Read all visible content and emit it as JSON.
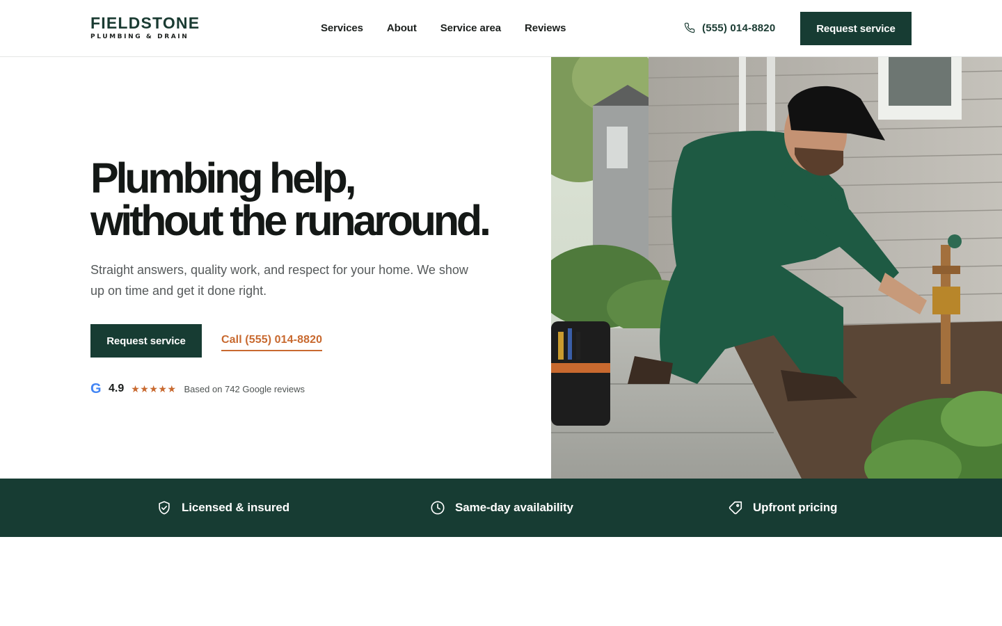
{
  "brand": {
    "name": "FIELDSTONE",
    "tagline": "PLUMBING & DRAIN"
  },
  "nav": {
    "items": [
      "Services",
      "About",
      "Service area",
      "Reviews"
    ]
  },
  "header": {
    "phone": "(555) 014-8820",
    "cta_label": "Request service"
  },
  "hero": {
    "title_line1": "Plumbing help,",
    "title_line2": "without the runaround.",
    "subtitle": "Straight answers, quality work, and respect for your home. We show up on time and get it done right.",
    "primary_cta": "Request service",
    "call_cta": "Call (555) 014-8820",
    "rating": {
      "g_mark": "G",
      "score": "4.9",
      "stars": "★★★★★",
      "star_count": 5,
      "reviews_text": "Based on 742 Google reviews"
    }
  },
  "trust": {
    "items": [
      {
        "icon": "shield-check-icon",
        "label": "Licensed & insured"
      },
      {
        "icon": "clock-icon",
        "label": "Same-day availability"
      },
      {
        "icon": "price-tag-icon",
        "label": "Upfront pricing"
      }
    ]
  },
  "colors": {
    "brand_green": "#173c33",
    "accent_orange": "#c8692f",
    "google_blue": "#4285f4"
  }
}
